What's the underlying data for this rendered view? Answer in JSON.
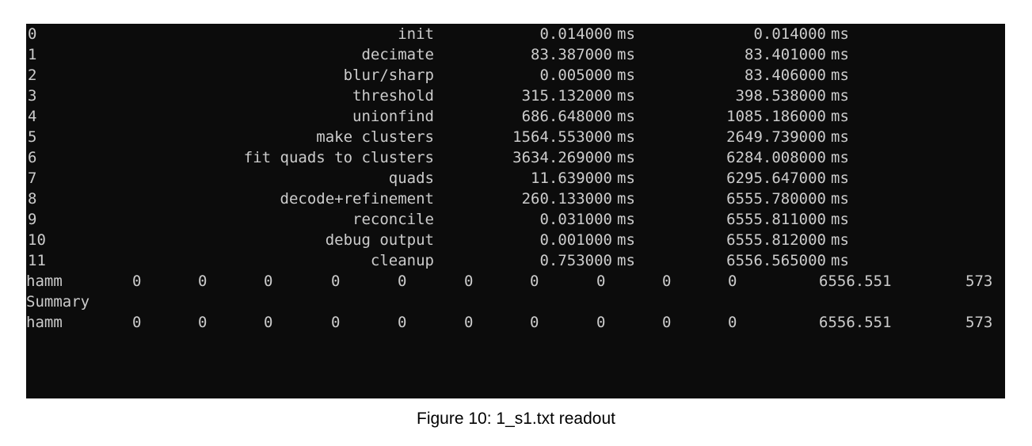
{
  "stage_rows": [
    {
      "idx": "0",
      "name": "init",
      "time": "0.014000",
      "cum": "0.014000",
      "unit": "ms"
    },
    {
      "idx": "1",
      "name": "decimate",
      "time": "83.387000",
      "cum": "83.401000",
      "unit": "ms"
    },
    {
      "idx": "2",
      "name": "blur/sharp",
      "time": "0.005000",
      "cum": "83.406000",
      "unit": "ms"
    },
    {
      "idx": "3",
      "name": "threshold",
      "time": "315.132000",
      "cum": "398.538000",
      "unit": "ms"
    },
    {
      "idx": "4",
      "name": "unionfind",
      "time": "686.648000",
      "cum": "1085.186000",
      "unit": "ms"
    },
    {
      "idx": "5",
      "name": "make clusters",
      "time": "1564.553000",
      "cum": "2649.739000",
      "unit": "ms"
    },
    {
      "idx": "6",
      "name": "fit quads to clusters",
      "time": "3634.269000",
      "cum": "6284.008000",
      "unit": "ms"
    },
    {
      "idx": "7",
      "name": "quads",
      "time": "11.639000",
      "cum": "6295.647000",
      "unit": "ms"
    },
    {
      "idx": "8",
      "name": "decode+refinement",
      "time": "260.133000",
      "cum": "6555.780000",
      "unit": "ms"
    },
    {
      "idx": "9",
      "name": "reconcile",
      "time": "0.031000",
      "cum": "6555.811000",
      "unit": "ms"
    },
    {
      "idx": "10",
      "name": "debug output",
      "time": "0.001000",
      "cum": "6555.812000",
      "unit": "ms"
    },
    {
      "idx": "11",
      "name": "cleanup",
      "time": "0.753000",
      "cum": "6556.565000",
      "unit": "ms"
    }
  ],
  "hamm_row_1": {
    "label": "hamm",
    "values": [
      "0",
      "0",
      "0",
      "0",
      "0",
      "0",
      "0",
      "0",
      "0",
      "0"
    ],
    "total": "6556.551",
    "count": "573"
  },
  "summary_label": "Summary",
  "hamm_row_2": {
    "label": "hamm",
    "values": [
      "0",
      "0",
      "0",
      "0",
      "0",
      "0",
      "0",
      "0",
      "0",
      "0"
    ],
    "total": "6556.551",
    "count": "573"
  },
  "caption": "Figure 10: 1_s1.txt readout",
  "colors": {
    "terminal_bg": "#0c0c0c",
    "terminal_fg": "#cccccc",
    "page_bg": "#ffffff"
  }
}
